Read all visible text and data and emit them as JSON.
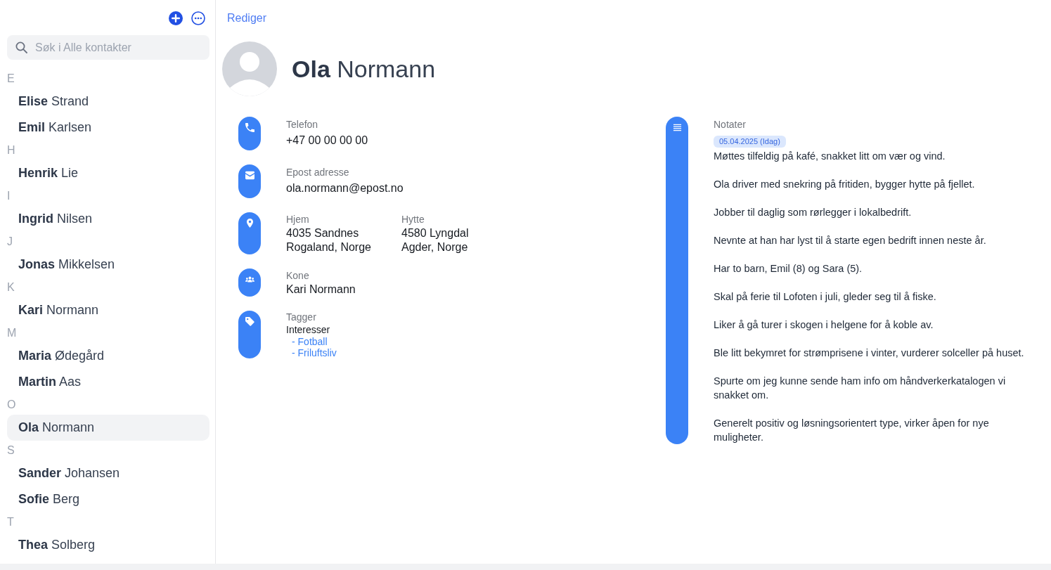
{
  "sidebar": {
    "search": {
      "placeholder": "Søk i Alle kontakter"
    },
    "groups": [
      {
        "letter": "E",
        "contacts": [
          {
            "first_name": "Elise",
            "last_name": "Strand",
            "selected": false
          },
          {
            "first_name": "Emil",
            "last_name": "Karlsen",
            "selected": false
          }
        ]
      },
      {
        "letter": "H",
        "contacts": [
          {
            "first_name": "Henrik",
            "last_name": "Lie",
            "selected": false
          }
        ]
      },
      {
        "letter": "I",
        "contacts": [
          {
            "first_name": "Ingrid",
            "last_name": "Nilsen",
            "selected": false
          }
        ]
      },
      {
        "letter": "J",
        "contacts": [
          {
            "first_name": "Jonas",
            "last_name": "Mikkelsen",
            "selected": false
          }
        ]
      },
      {
        "letter": "K",
        "contacts": [
          {
            "first_name": "Kari",
            "last_name": "Normann",
            "selected": false
          }
        ]
      },
      {
        "letter": "M",
        "contacts": [
          {
            "first_name": "Maria",
            "last_name": "Ødegård",
            "selected": false
          },
          {
            "first_name": "Martin",
            "last_name": "Aas",
            "selected": false
          }
        ]
      },
      {
        "letter": "O",
        "contacts": [
          {
            "first_name": "Ola",
            "last_name": "Normann",
            "selected": true
          }
        ]
      },
      {
        "letter": "S",
        "contacts": [
          {
            "first_name": "Sander",
            "last_name": "Johansen",
            "selected": false
          },
          {
            "first_name": "Sofie",
            "last_name": "Berg",
            "selected": false
          }
        ]
      },
      {
        "letter": "T",
        "contacts": [
          {
            "first_name": "Thea",
            "last_name": "Solberg",
            "selected": false
          }
        ]
      }
    ]
  },
  "contact": {
    "edit_link": "Rediger",
    "first_name": "Ola",
    "last_name": "Normann",
    "details": [
      {
        "kind": "phone",
        "label": "Telefon",
        "value": "+47 00 00 00 00"
      },
      {
        "kind": "email",
        "label": "Epost adresse",
        "value": "ola.normann@epost.no"
      },
      {
        "kind": "address",
        "addresses": [
          {
            "label": "Hjem",
            "lines": [
              "4035 Sandnes",
              "Rogaland, Norge"
            ]
          },
          {
            "label": "Hytte",
            "lines": [
              "4580 Lyngdal",
              "Agder, Norge"
            ]
          }
        ]
      },
      {
        "kind": "relation",
        "label": "Kone",
        "value": "Kari Normann"
      },
      {
        "kind": "tags",
        "label": "Tagger",
        "groups": [
          {
            "name": "Interesser",
            "tags": [
              "- Fotball",
              "- Friluftsliv"
            ]
          }
        ]
      }
    ],
    "notes": {
      "label": "Notater",
      "date": "05.04.2025 (Idag)",
      "paragraphs": [
        "Møttes tilfeldig på kafé, snakket litt om vær og vind.",
        "Ola driver med snekring på fritiden, bygger hytte på fjellet.",
        "Jobber til daglig som rørlegger i lokalbedrift.",
        "Nevnte at han har lyst til å starte egen bedrift innen neste år.",
        "Har to barn, Emil (8) og Sara (5).",
        "Skal på ferie til Lofoten i juli, gleder seg til å fiske.",
        "Liker å gå turer i skogen i helgene for å koble av.",
        "Ble litt bekymret for strømprisene i vinter, vurderer solceller på huset.",
        "Spurte om jeg kunne sende ham info om håndverkerkatalogen vi snakket om.",
        "Generelt positiv og løsningsorientert type, virker åpen for nye muligheter."
      ]
    }
  }
}
